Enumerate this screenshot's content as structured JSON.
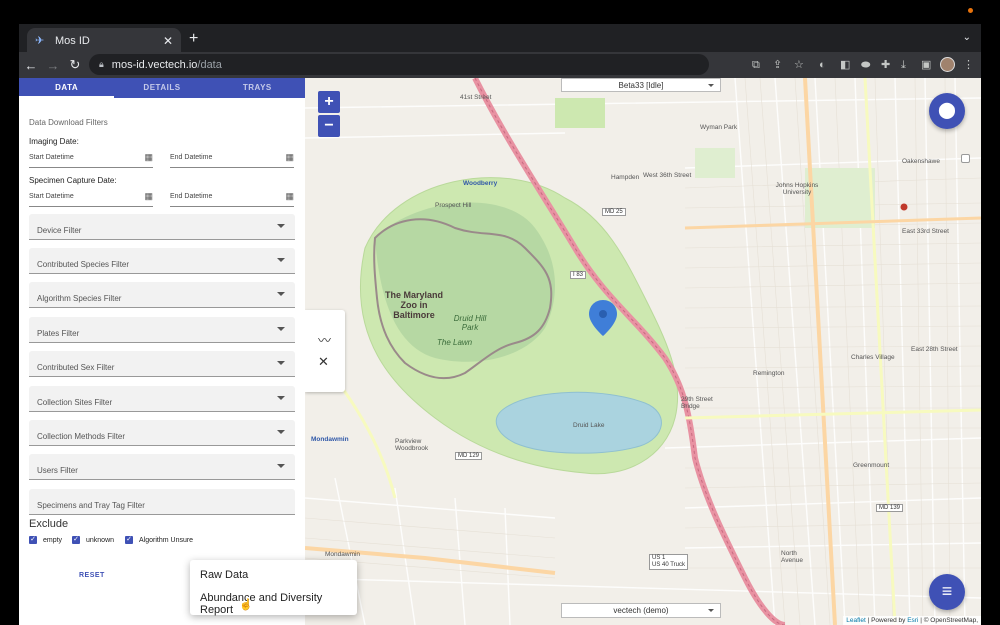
{
  "browser": {
    "tab_title": "Mos ID",
    "url_host": "mos-id.vectech.io",
    "url_path": "/data"
  },
  "sidebar": {
    "tabs": [
      "DATA",
      "DETAILS",
      "TRAYS"
    ],
    "section_title": "Data Download Filters",
    "imaging_date_label": "Imaging Date:",
    "specimen_capture_label": "Specimen Capture Date:",
    "start_placeholder": "Start Datetime",
    "end_placeholder": "End Datetime",
    "filters": [
      "Device Filter",
      "Contributed Species Filter",
      "Algorithm Species Filter",
      "Plates Filter",
      "Contributed Sex Filter",
      "Collection Sites Filter",
      "Collection Methods Filter",
      "Users Filter",
      "Specimens and Tray Tag Filter"
    ],
    "exclude_label": "Exclude",
    "exclude_options": [
      "empty",
      "unknown",
      "Algorithm Unsure"
    ],
    "reset_label": "RESET"
  },
  "map": {
    "device_select": "Beta33 [Idle]",
    "org_select": "vectech (demo)",
    "labels": {
      "street_41": "41st Street",
      "woodberry": "Woodberry",
      "prospect_hill": "Prospect Hill",
      "hampden": "Hampden",
      "w36": "West 36th Street",
      "jhu": "Johns Hopkins University",
      "e33": "East 33rd Street",
      "zoo": "The Maryland Zoo in Baltimore",
      "druid": "Druid Hill Park",
      "lawn": "The Lawn",
      "mondawmin": "Mondawmin",
      "parkview": "Parkview Woodbrook",
      "remington": "Remington",
      "charles": "Charles Village",
      "e28": "East 28th Street",
      "druid_lake": "Druid Lake",
      "bridge29": "29th Street Bridge",
      "greenmount": "Greenmount",
      "oakenshawe": "Oakenshawe",
      "wyman": "Wyman Park",
      "north_ave": "North Avenue",
      "md25": "MD 25",
      "md129": "MD 129",
      "md139": "MD 139",
      "i83": "I 83",
      "us1": "US 1\nUS 40 Truck"
    },
    "attribution": {
      "leaflet": "Leaflet",
      "powered": " | Powered by ",
      "esri": "Esri",
      "osm": " | © OpenStreetMap,"
    }
  },
  "popup": {
    "items": [
      "Raw Data",
      "Abundance and Diversity Report"
    ]
  },
  "colors": {
    "primary": "#3f51b5",
    "park": "#cde8b0",
    "water": "#aad3df",
    "highway": "#e892a2"
  }
}
